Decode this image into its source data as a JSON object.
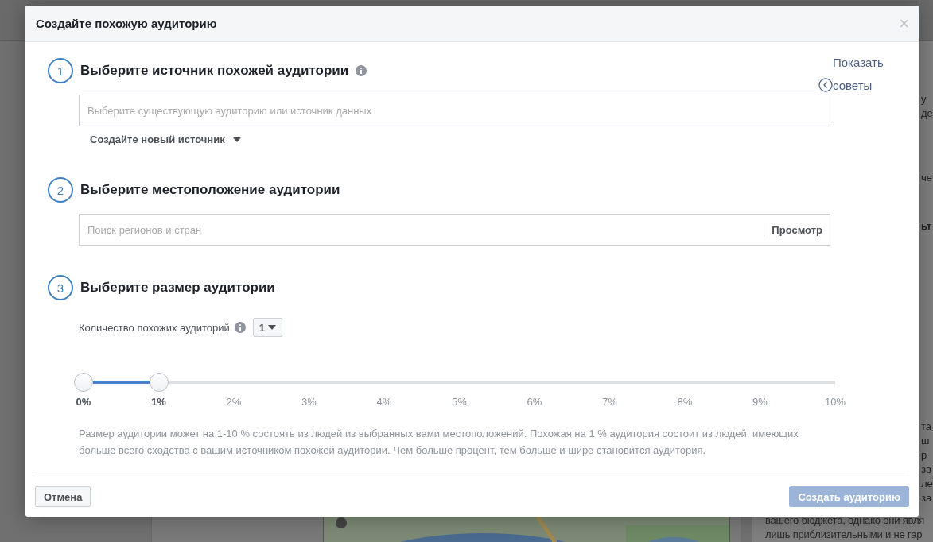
{
  "background": {
    "fragments": [
      {
        "text": "у",
        "bold": false
      },
      {
        "text": "де",
        "bold": false
      },
      {
        "text": "че",
        "bold": false
      },
      {
        "text": "ьт",
        "bold": true
      },
      {
        "text": "та",
        "bold": false
      },
      {
        "text": "ш",
        "bold": false
      },
      {
        "text": "р",
        "bold": false
      },
      {
        "text": "зв",
        "bold": false
      },
      {
        "text": "ле",
        "bold": false
      },
      {
        "text": "за",
        "bold": false
      }
    ],
    "lines": [
      "вашего бюджета, однако они явля",
      "лишь приблизительными и не гар"
    ]
  },
  "modal": {
    "title": "Создайте похожую аудиторию",
    "close": "×",
    "tips": "Показать советы",
    "sections": [
      {
        "kind": "source",
        "number": "1",
        "title": "Выберите источник похожей аудитории",
        "info": true,
        "placeholder": "Выберите существующую аудиторию или источник данных",
        "link": "Создайте новый источник"
      },
      {
        "kind": "location",
        "number": "2",
        "title": "Выберите местоположение аудитории",
        "info": false,
        "placeholder": "Поиск регионов и стран",
        "button": "Просмотр"
      },
      {
        "kind": "size",
        "number": "3",
        "title": "Выберите размер аудитории",
        "info": false,
        "count_label": "Количество похожих аудиторий",
        "count_value": "1",
        "slider": {
          "level": 0.1,
          "ticks": [
            {
              "label": "0%",
              "active": true
            },
            {
              "label": "1%",
              "active": true
            },
            {
              "label": "2%",
              "active": false
            },
            {
              "label": "3%",
              "active": false
            },
            {
              "label": "4%",
              "active": false
            },
            {
              "label": "5%",
              "active": false
            },
            {
              "label": "6%",
              "active": false
            },
            {
              "label": "7%",
              "active": false
            },
            {
              "label": "8%",
              "active": false
            },
            {
              "label": "9%",
              "active": false
            },
            {
              "label": "10%",
              "active": false
            }
          ]
        },
        "description": "Размер аудитории может на 1-10 % состоять из людей из выбранных вами местоположений. Похожая на 1 % аудитория состоит из людей, имеющих больше всего сходства с вашим источником похожей аудитории. Чем больше процент, тем больше и шире становится аудитория."
      }
    ],
    "cancel": "Отмена",
    "submit": {
      "label": "Создать аудиторию",
      "disabled": true
    }
  }
}
